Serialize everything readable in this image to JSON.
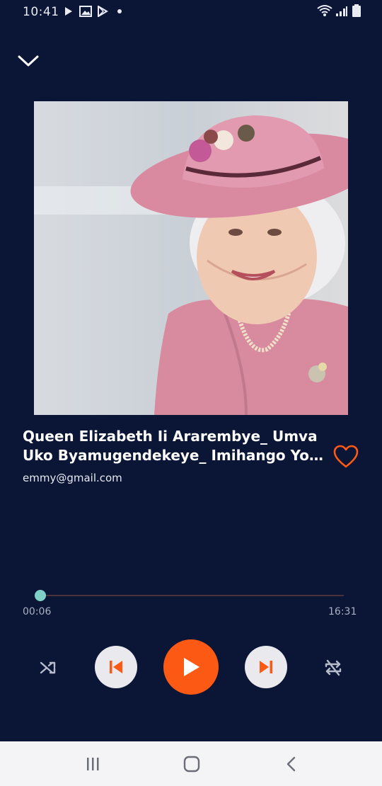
{
  "status_bar": {
    "time": "10:41",
    "icons": [
      "play-icon",
      "image-icon",
      "play-store-icon",
      "dot-icon",
      "wifi-icon",
      "signal-icon",
      "battery-icon"
    ]
  },
  "player": {
    "title_line1": "Queen Elizabeth Ii Ararembye_ Umva",
    "title_line2": "Uko Byamugendekeye_ Imihango Yo ...",
    "artist": "emmy@gmail.com",
    "current_time": "00:06",
    "total_time": "16:31",
    "progress_fraction": 0.006,
    "liked": false
  },
  "controls": [
    "shuffle-icon",
    "previous-icon",
    "play-icon",
    "next-icon",
    "repeat-icon"
  ],
  "nav": [
    "recent-apps-icon",
    "home-icon",
    "back-icon"
  ],
  "colors": {
    "background": "#0b1535",
    "accent": "#fc5a14",
    "seek_thumb": "#7fd1c8"
  }
}
